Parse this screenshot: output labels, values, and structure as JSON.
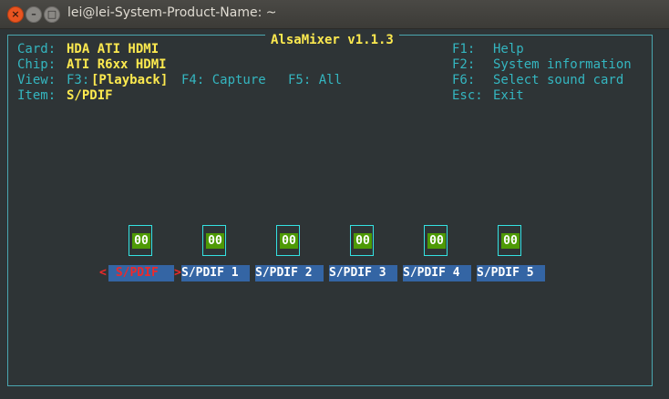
{
  "window": {
    "title": "lei@lei-System-Product-Name: ~",
    "close_glyph": "×",
    "min_glyph": "–",
    "max_glyph": "□"
  },
  "app": {
    "title": "AlsaMixer v1.1.3"
  },
  "info": {
    "card_label": "Card:",
    "card_value": "HDA ATI HDMI",
    "chip_label": "Chip:",
    "chip_value": "ATI R6xx HDMI",
    "view_label": "View:",
    "view_f3": "F3:",
    "view_playback": "[Playback]",
    "view_f4": "F4: Capture",
    "view_f5": "F5: All",
    "item_label": "Item:",
    "item_value": "S/PDIF"
  },
  "help": [
    {
      "key": "F1:",
      "action": "Help"
    },
    {
      "key": "F2:",
      "action": "System information"
    },
    {
      "key": "F6:",
      "action": "Select sound card"
    },
    {
      "key": "Esc:",
      "action": "Exit"
    }
  ],
  "controls": [
    {
      "level": "00",
      "label": " S/PDIF "
    },
    {
      "level": "00",
      "label": "S/PDIF 1"
    },
    {
      "level": "00",
      "label": "S/PDIF 2"
    },
    {
      "level": "00",
      "label": "S/PDIF 3"
    },
    {
      "level": "00",
      "label": "S/PDIF 4"
    },
    {
      "level": "00",
      "label": "S/PDIF 5"
    }
  ],
  "selection_arrows": {
    "left": "<",
    "right": ">"
  },
  "colors": {
    "frame": "#4aa7b0",
    "accent_yellow": "#fce94f",
    "label_bg": "#3465a4",
    "selected_label": "#ef2929",
    "level_bg": "#4e9a06"
  }
}
